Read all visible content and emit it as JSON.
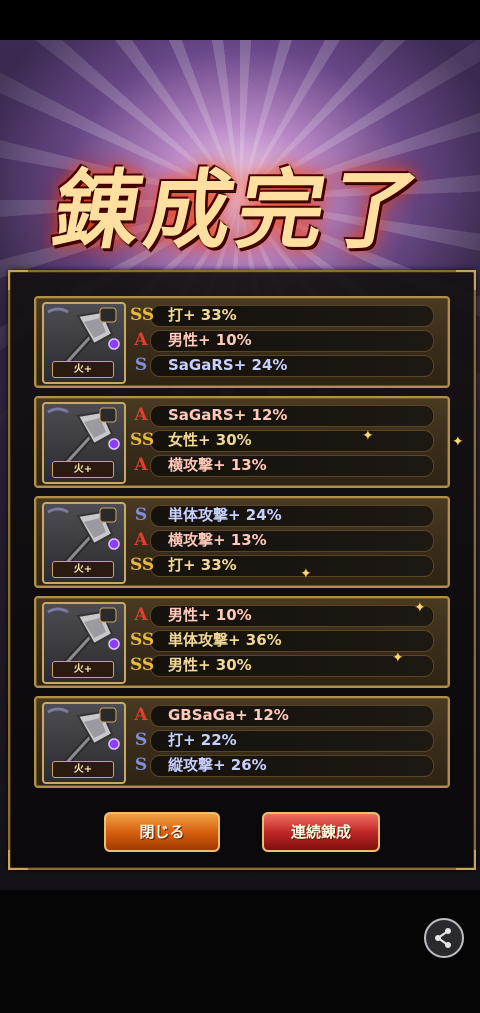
{
  "title": "錬成完了",
  "cards": [
    {
      "element": "火+",
      "rows": [
        {
          "icon": "SS",
          "color": "gold",
          "text": "打+ 33%"
        },
        {
          "icon": "A",
          "color": "red",
          "text": "男性+ 10%"
        },
        {
          "icon": "S",
          "color": "blue",
          "text": "SaGaRS+ 24%"
        }
      ]
    },
    {
      "element": "火+",
      "rows": [
        {
          "icon": "A",
          "color": "red",
          "text": "SaGaRS+ 12%"
        },
        {
          "icon": "SS",
          "color": "gold",
          "text": "女性+ 30%"
        },
        {
          "icon": "A",
          "color": "red",
          "text": "横攻撃+ 13%"
        }
      ]
    },
    {
      "element": "火+",
      "rows": [
        {
          "icon": "S",
          "color": "blue",
          "text": "単体攻撃+ 24%"
        },
        {
          "icon": "A",
          "color": "red",
          "text": "横攻撃+ 13%"
        },
        {
          "icon": "SS",
          "color": "gold",
          "text": "打+ 33%"
        }
      ]
    },
    {
      "element": "火+",
      "rows": [
        {
          "icon": "A",
          "color": "red",
          "text": "男性+ 10%"
        },
        {
          "icon": "SS",
          "color": "gold",
          "text": "単体攻撃+ 36%"
        },
        {
          "icon": "SS",
          "color": "gold",
          "text": "男性+ 30%"
        }
      ]
    },
    {
      "element": "火+",
      "rows": [
        {
          "icon": "A",
          "color": "red",
          "text": "GBSaGa+ 12%"
        },
        {
          "icon": "S",
          "color": "blue",
          "text": "打+ 22%"
        },
        {
          "icon": "S",
          "color": "blue",
          "text": "縦攻撃+ 26%"
        }
      ]
    }
  ],
  "buttons": {
    "close": "閉じる",
    "continue": "連続錬成"
  },
  "share_icon": "share-icon"
}
